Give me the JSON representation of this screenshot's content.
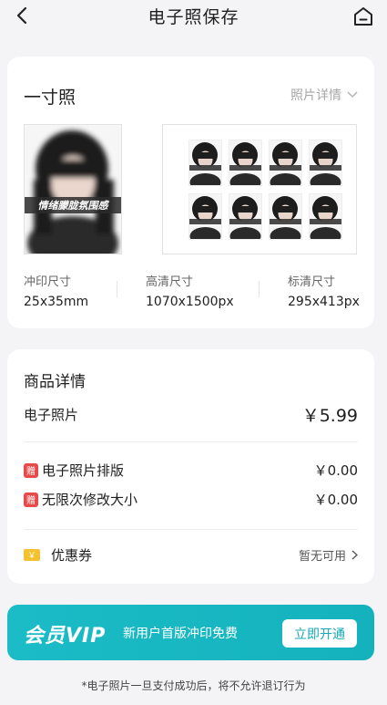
{
  "nav": {
    "title": "电子照保存"
  },
  "photo": {
    "title": "一寸照",
    "detail_link": "照片详情",
    "overlay_text": "情绪朦胧氛围感",
    "specs": [
      {
        "label": "冲印尺寸",
        "value": "25x35mm"
      },
      {
        "label": "高清尺寸",
        "value": "1070x1500px"
      },
      {
        "label": "标清尺寸",
        "value": "295x413px"
      }
    ]
  },
  "product": {
    "title": "商品详情",
    "main_item": {
      "label": "电子照片",
      "price": "￥5.99"
    },
    "gifts": [
      {
        "badge": "赠",
        "label": "电子照片排版",
        "price": "￥0.00"
      },
      {
        "badge": "赠",
        "label": "无限次修改大小",
        "price": "￥0.00"
      }
    ],
    "coupon": {
      "icon_text": "￥",
      "label": "优惠券",
      "value": "暂无可用"
    }
  },
  "vip": {
    "logo": "会员VIP",
    "text": "新用户首版冲印免费",
    "button": "立即开通"
  },
  "footer_note": "*电子照片一旦支付成功后，将不允许退订行为",
  "colors": {
    "accent": "#16a9b4",
    "gift_badge": "#e84a4a",
    "coupon": "#f4c230"
  }
}
